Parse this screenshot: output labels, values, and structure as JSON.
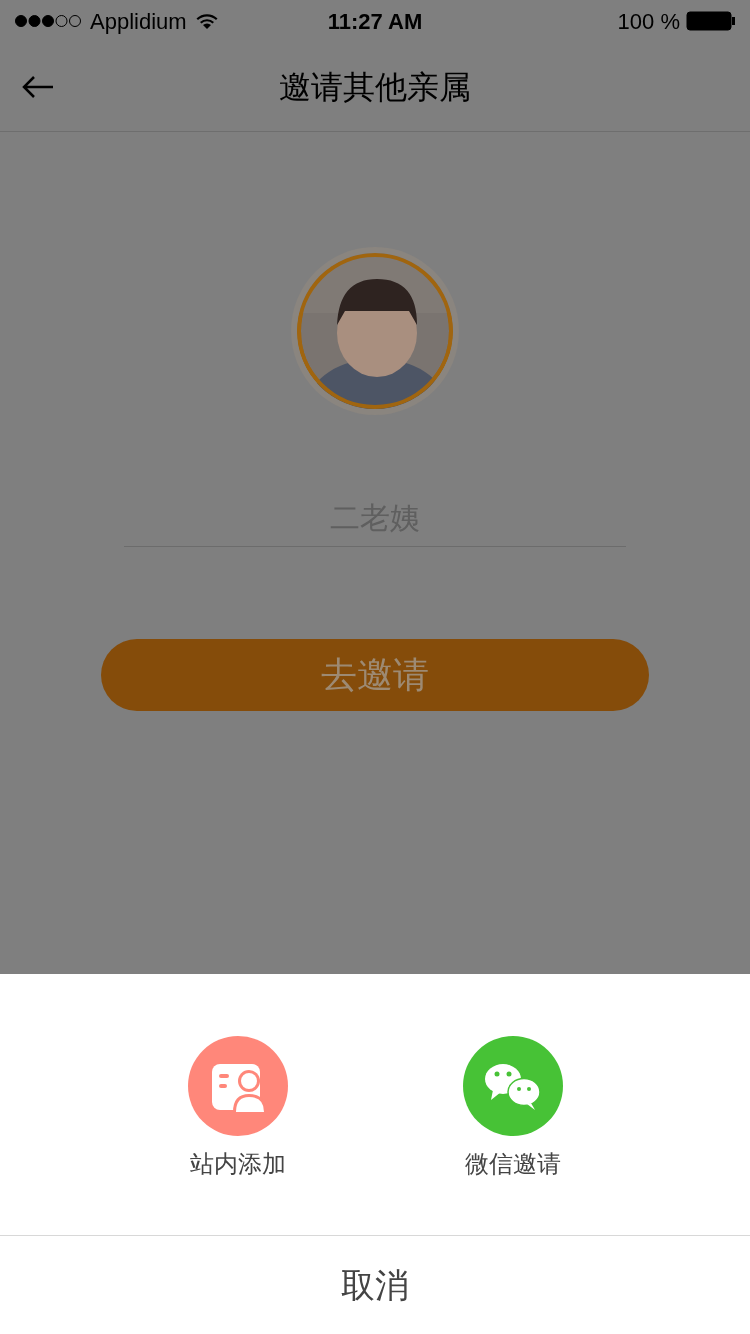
{
  "status_bar": {
    "carrier": "Applidium",
    "time": "11:27 AM",
    "battery": "100 %"
  },
  "nav": {
    "title": "邀请其他亲属"
  },
  "name_field": {
    "placeholder": "二老姨"
  },
  "invite_button": {
    "label": "去邀请"
  },
  "sheet": {
    "options": [
      {
        "kind": "station",
        "label": "站内添加"
      },
      {
        "kind": "wechat",
        "label": "微信邀请"
      }
    ],
    "cancel": "取消"
  }
}
